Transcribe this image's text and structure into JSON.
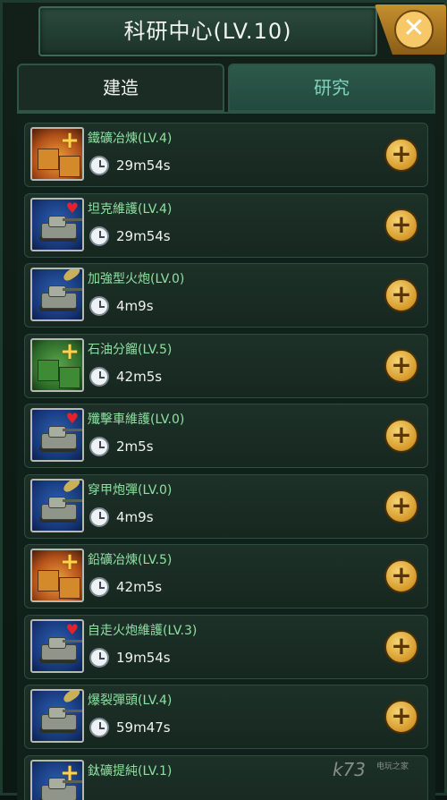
{
  "header": {
    "title": "科研中心(LV.10)",
    "close_symbol": "✕"
  },
  "tabs": [
    {
      "label": "建造",
      "active": false
    },
    {
      "label": "研究",
      "active": true
    }
  ],
  "items": [
    {
      "name": "鐵礦冶煉(LV.4)",
      "time": "29m54s",
      "icon": "iron-smelting-icon",
      "badge": "plus",
      "theme": "orange"
    },
    {
      "name": "坦克維護(LV.4)",
      "time": "29m54s",
      "icon": "tank-repair-icon",
      "badge": "heart",
      "theme": "blue"
    },
    {
      "name": "加強型火炮(LV.0)",
      "time": "4m9s",
      "icon": "enhanced-artillery-icon",
      "badge": "shell",
      "theme": "blue"
    },
    {
      "name": "石油分餾(LV.5)",
      "time": "42m5s",
      "icon": "oil-refining-icon",
      "badge": "plus",
      "theme": "green"
    },
    {
      "name": "殲擊車維護(LV.0)",
      "time": "2m5s",
      "icon": "destroyer-repair-icon",
      "badge": "heart",
      "theme": "blue"
    },
    {
      "name": "穿甲炮彈(LV.0)",
      "time": "4m9s",
      "icon": "armor-piercing-shell-icon",
      "badge": "shell",
      "theme": "blue"
    },
    {
      "name": "鉛礦冶煉(LV.5)",
      "time": "42m5s",
      "icon": "lead-smelting-icon",
      "badge": "plus",
      "theme": "orange"
    },
    {
      "name": "自走火炮維護(LV.3)",
      "time": "19m54s",
      "icon": "self-propelled-gun-repair-icon",
      "badge": "heart",
      "theme": "blue"
    },
    {
      "name": "爆裂彈頭(LV.4)",
      "time": "59m47s",
      "icon": "explosive-warhead-icon",
      "badge": "shell",
      "theme": "blue"
    },
    {
      "name": "鈦礦提純(LV.1)",
      "time": "",
      "icon": "titanium-purification-icon",
      "badge": "plus",
      "theme": "blue"
    }
  ],
  "add_symbol": "+",
  "watermark": {
    "brand": "k73",
    "sub": "电玩之家"
  }
}
